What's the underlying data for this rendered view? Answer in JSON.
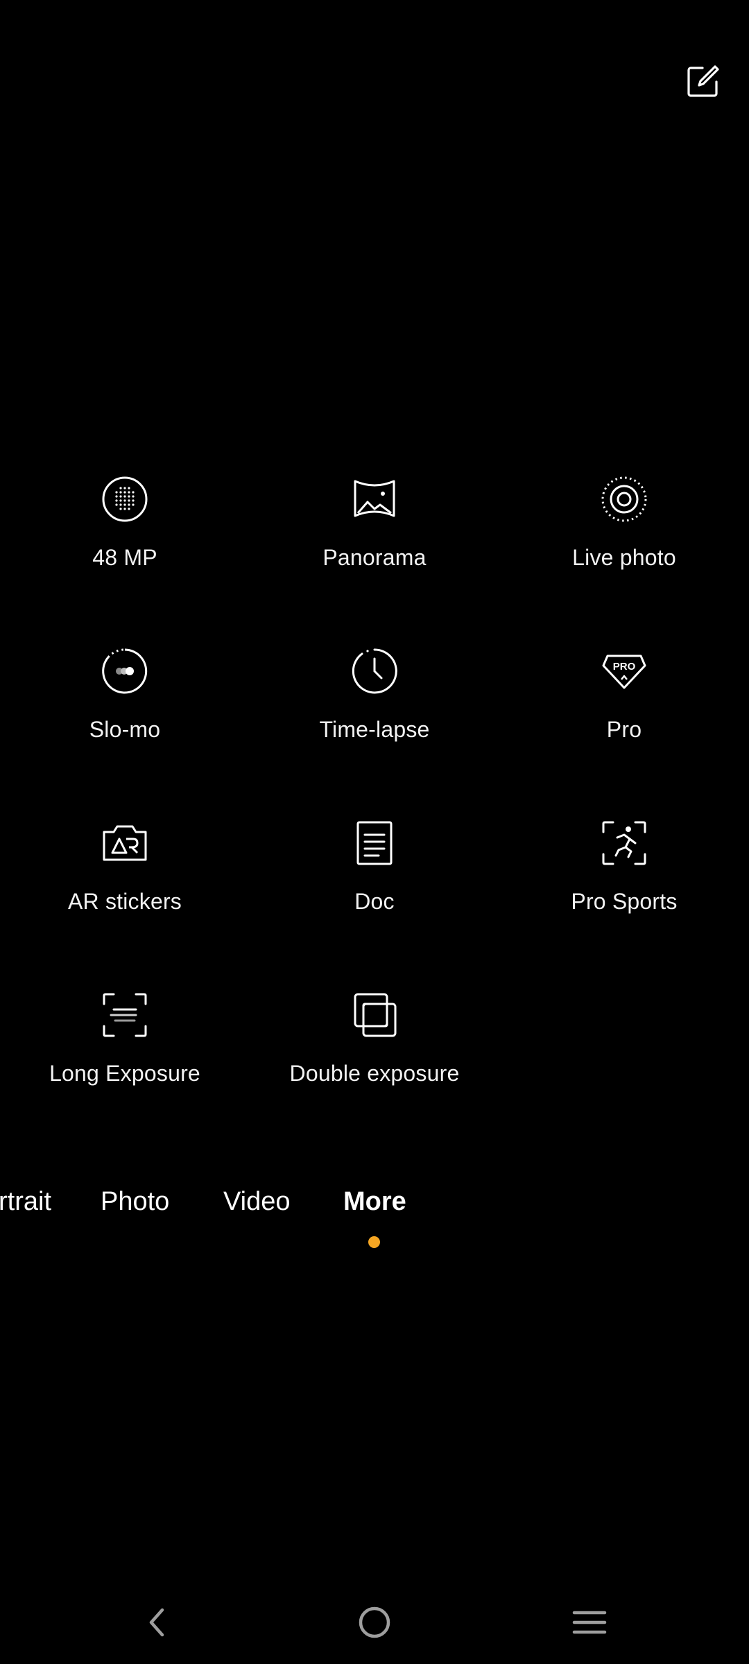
{
  "top_bar": {
    "edit_icon": "edit-square-icon"
  },
  "modes": [
    {
      "id": "48mp",
      "label": "48 MP",
      "icon": "dotted-sphere-icon"
    },
    {
      "id": "panorama",
      "label": "Panorama",
      "icon": "panorama-icon"
    },
    {
      "id": "live-photo",
      "label": "Live photo",
      "icon": "live-photo-icon"
    },
    {
      "id": "slo-mo",
      "label": "Slo-mo",
      "icon": "slow-motion-icon"
    },
    {
      "id": "time-lapse",
      "label": "Time-lapse",
      "icon": "clock-icon"
    },
    {
      "id": "pro",
      "label": "Pro",
      "icon": "pro-badge-icon"
    },
    {
      "id": "ar-stickers",
      "label": "AR stickers",
      "icon": "ar-camera-icon"
    },
    {
      "id": "doc",
      "label": "Doc",
      "icon": "document-icon"
    },
    {
      "id": "pro-sports",
      "label": "Pro Sports",
      "icon": "runner-frame-icon"
    },
    {
      "id": "long-exposure",
      "label": "Long Exposure",
      "icon": "long-exposure-icon"
    },
    {
      "id": "double-exposure",
      "label": "Double exposure",
      "icon": "double-exposure-icon"
    }
  ],
  "mode_tabs": [
    {
      "label": "rtrait",
      "active": false
    },
    {
      "label": "Photo",
      "active": false
    },
    {
      "label": "Video",
      "active": false
    },
    {
      "label": "More",
      "active": true
    }
  ],
  "accent_color": "#f5a623",
  "nav": {
    "back_icon": "back-chevron-icon",
    "home_icon": "home-circle-icon",
    "recents_icon": "menu-lines-icon"
  }
}
